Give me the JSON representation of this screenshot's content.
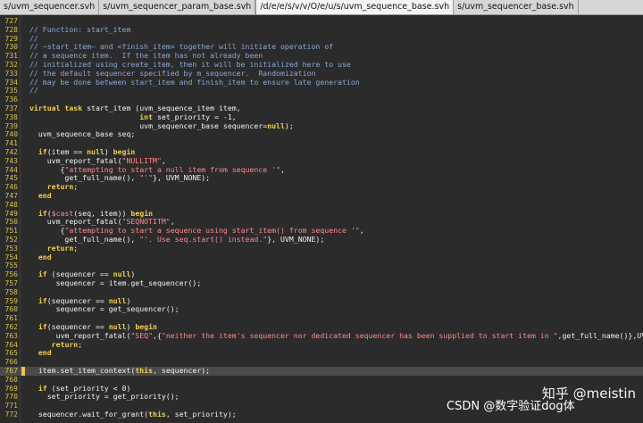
{
  "tabs": [
    {
      "label": "s/uvm_sequencer.svh"
    },
    {
      "label": "s/uvm_sequencer_param_base.svh"
    },
    {
      "label": "/d/e/e/s/v/v/O/e/u/s/uvm_sequence_base.svh"
    },
    {
      "label": "s/uvm_sequencer_base.svh"
    }
  ],
  "active_tab_index": 2,
  "editor": {
    "highlighted_line": 767,
    "lines": [
      {
        "num": "727",
        "segs": []
      },
      {
        "num": "728",
        "segs": [
          {
            "t": "// Function: start_item",
            "c": "cmt"
          }
        ]
      },
      {
        "num": "729",
        "segs": [
          {
            "t": "//",
            "c": "cmt"
          }
        ]
      },
      {
        "num": "730",
        "segs": [
          {
            "t": "// ~start_item~ and <finish_item> together will initiate operation of",
            "c": "cmt"
          }
        ]
      },
      {
        "num": "731",
        "segs": [
          {
            "t": "// a sequence item.  If the item has not already been",
            "c": "cmt"
          }
        ]
      },
      {
        "num": "732",
        "segs": [
          {
            "t": "// initialized using create_item, then it will be initialized here to use",
            "c": "cmt"
          }
        ]
      },
      {
        "num": "733",
        "segs": [
          {
            "t": "// the default sequencer specified by m_sequencer.  Randomization",
            "c": "cmt"
          }
        ]
      },
      {
        "num": "734",
        "segs": [
          {
            "t": "// may be done between start_item and finish_item to ensure late generation",
            "c": "cmt"
          }
        ]
      },
      {
        "num": "735",
        "segs": [
          {
            "t": "//",
            "c": "cmt"
          }
        ]
      },
      {
        "num": "736",
        "segs": []
      },
      {
        "num": "737",
        "segs": [
          {
            "t": "virtual task",
            "c": "kw"
          },
          {
            "t": " start_item (uvm_sequence_item item,",
            "c": ""
          }
        ]
      },
      {
        "num": "738",
        "segs": [
          {
            "t": "                         ",
            "c": ""
          },
          {
            "t": "int",
            "c": "kw"
          },
          {
            "t": " set_priority = -1,",
            "c": ""
          }
        ]
      },
      {
        "num": "739",
        "segs": [
          {
            "t": "                         uvm_sequencer_base sequencer=",
            "c": ""
          },
          {
            "t": "null",
            "c": "kw"
          },
          {
            "t": ");",
            "c": ""
          }
        ]
      },
      {
        "num": "740",
        "segs": [
          {
            "t": "  uvm_sequence_base seq;",
            "c": ""
          }
        ]
      },
      {
        "num": "741",
        "segs": []
      },
      {
        "num": "742",
        "segs": [
          {
            "t": "  ",
            "c": ""
          },
          {
            "t": "if",
            "c": "kw"
          },
          {
            "t": "(item == ",
            "c": ""
          },
          {
            "t": "null",
            "c": "kw"
          },
          {
            "t": ") ",
            "c": ""
          },
          {
            "t": "begin",
            "c": "kw"
          }
        ]
      },
      {
        "num": "743",
        "segs": [
          {
            "t": "    uvm_report_fatal(",
            "c": ""
          },
          {
            "t": "\"NULLITM\"",
            "c": "str"
          },
          {
            "t": ",",
            "c": ""
          }
        ]
      },
      {
        "num": "744",
        "segs": [
          {
            "t": "       {",
            "c": ""
          },
          {
            "t": "\"attempting to start a null item from sequence '\"",
            "c": "str"
          },
          {
            "t": ",",
            "c": ""
          }
        ]
      },
      {
        "num": "745",
        "segs": [
          {
            "t": "        get_full_name(), ",
            "c": ""
          },
          {
            "t": "\"'\"",
            "c": "str"
          },
          {
            "t": "}, UVM_NONE);",
            "c": ""
          }
        ]
      },
      {
        "num": "746",
        "segs": [
          {
            "t": "    ",
            "c": ""
          },
          {
            "t": "return",
            "c": "kw"
          },
          {
            "t": ";",
            "c": ""
          }
        ]
      },
      {
        "num": "747",
        "segs": [
          {
            "t": "  ",
            "c": ""
          },
          {
            "t": "end",
            "c": "kw"
          }
        ]
      },
      {
        "num": "748",
        "segs": []
      },
      {
        "num": "749",
        "segs": [
          {
            "t": "  ",
            "c": ""
          },
          {
            "t": "if",
            "c": "kw"
          },
          {
            "t": "(",
            "c": ""
          },
          {
            "t": "$cast",
            "c": "mac"
          },
          {
            "t": "(seq, item)) ",
            "c": ""
          },
          {
            "t": "begin",
            "c": "kw"
          }
        ]
      },
      {
        "num": "750",
        "segs": [
          {
            "t": "    uvm_report_fatal(",
            "c": ""
          },
          {
            "t": "\"SEQNOTITM\"",
            "c": "str"
          },
          {
            "t": ",",
            "c": ""
          }
        ]
      },
      {
        "num": "751",
        "segs": [
          {
            "t": "       {",
            "c": ""
          },
          {
            "t": "\"attempting to start a sequence using start_item() from sequence '\"",
            "c": "str"
          },
          {
            "t": ",",
            "c": ""
          }
        ]
      },
      {
        "num": "752",
        "segs": [
          {
            "t": "        get_full_name(), ",
            "c": ""
          },
          {
            "t": "\"'. Use seq.start() instead.\"",
            "c": "str"
          },
          {
            "t": "}, UVM_NONE);",
            "c": ""
          }
        ]
      },
      {
        "num": "753",
        "segs": [
          {
            "t": "    ",
            "c": ""
          },
          {
            "t": "return",
            "c": "kw"
          },
          {
            "t": ";",
            "c": ""
          }
        ]
      },
      {
        "num": "754",
        "segs": [
          {
            "t": "  ",
            "c": ""
          },
          {
            "t": "end",
            "c": "kw"
          }
        ]
      },
      {
        "num": "755",
        "segs": []
      },
      {
        "num": "756",
        "segs": [
          {
            "t": "  ",
            "c": ""
          },
          {
            "t": "if",
            "c": "kw"
          },
          {
            "t": " (sequencer == ",
            "c": ""
          },
          {
            "t": "null",
            "c": "kw"
          },
          {
            "t": ")",
            "c": ""
          }
        ]
      },
      {
        "num": "757",
        "segs": [
          {
            "t": "      sequencer = item.get_sequencer();",
            "c": ""
          }
        ]
      },
      {
        "num": "758",
        "segs": []
      },
      {
        "num": "759",
        "segs": [
          {
            "t": "  ",
            "c": ""
          },
          {
            "t": "if",
            "c": "kw"
          },
          {
            "t": "(sequencer == ",
            "c": ""
          },
          {
            "t": "null",
            "c": "kw"
          },
          {
            "t": ")",
            "c": ""
          }
        ]
      },
      {
        "num": "760",
        "segs": [
          {
            "t": "      sequencer = get_sequencer();",
            "c": ""
          }
        ]
      },
      {
        "num": "761",
        "segs": []
      },
      {
        "num": "762",
        "segs": [
          {
            "t": "  ",
            "c": ""
          },
          {
            "t": "if",
            "c": "kw"
          },
          {
            "t": "(sequencer == ",
            "c": ""
          },
          {
            "t": "null",
            "c": "kw"
          },
          {
            "t": ") ",
            "c": ""
          },
          {
            "t": "begin",
            "c": "kw"
          }
        ]
      },
      {
        "num": "763",
        "segs": [
          {
            "t": "      uvm_report_fatal(",
            "c": ""
          },
          {
            "t": "\"SEQ\"",
            "c": "str"
          },
          {
            "t": ",{",
            "c": ""
          },
          {
            "t": "\"neither the item's sequencer nor dedicated sequencer has been supplied to start item in \"",
            "c": "str"
          },
          {
            "t": ",get_full_name()},UVM_NONE);",
            "c": ""
          }
        ]
      },
      {
        "num": "764",
        "segs": [
          {
            "t": "     ",
            "c": ""
          },
          {
            "t": "return",
            "c": "kw"
          },
          {
            "t": ";",
            "c": ""
          }
        ]
      },
      {
        "num": "765",
        "segs": [
          {
            "t": "  ",
            "c": ""
          },
          {
            "t": "end",
            "c": "kw"
          }
        ]
      },
      {
        "num": "766",
        "segs": []
      },
      {
        "num": "767",
        "segs": [
          {
            "t": "  item.set_item_context(",
            "c": ""
          },
          {
            "t": "this",
            "c": "kw"
          },
          {
            "t": ", sequencer);",
            "c": ""
          }
        ]
      },
      {
        "num": "768",
        "segs": []
      },
      {
        "num": "769",
        "segs": [
          {
            "t": "  ",
            "c": ""
          },
          {
            "t": "if",
            "c": "kw"
          },
          {
            "t": " (set_priority < 0)",
            "c": ""
          }
        ]
      },
      {
        "num": "770",
        "segs": [
          {
            "t": "    set_priority = get_priority();",
            "c": ""
          }
        ]
      },
      {
        "num": "771",
        "segs": []
      },
      {
        "num": "772",
        "segs": [
          {
            "t": "  sequencer.wait_for_grant(",
            "c": ""
          },
          {
            "t": "this",
            "c": "kw"
          },
          {
            "t": ", set_priority);",
            "c": ""
          }
        ]
      }
    ]
  },
  "watermark": {
    "line1": "CSDN @数字验证dog体",
    "zhihu": "知乎 @meistin"
  }
}
